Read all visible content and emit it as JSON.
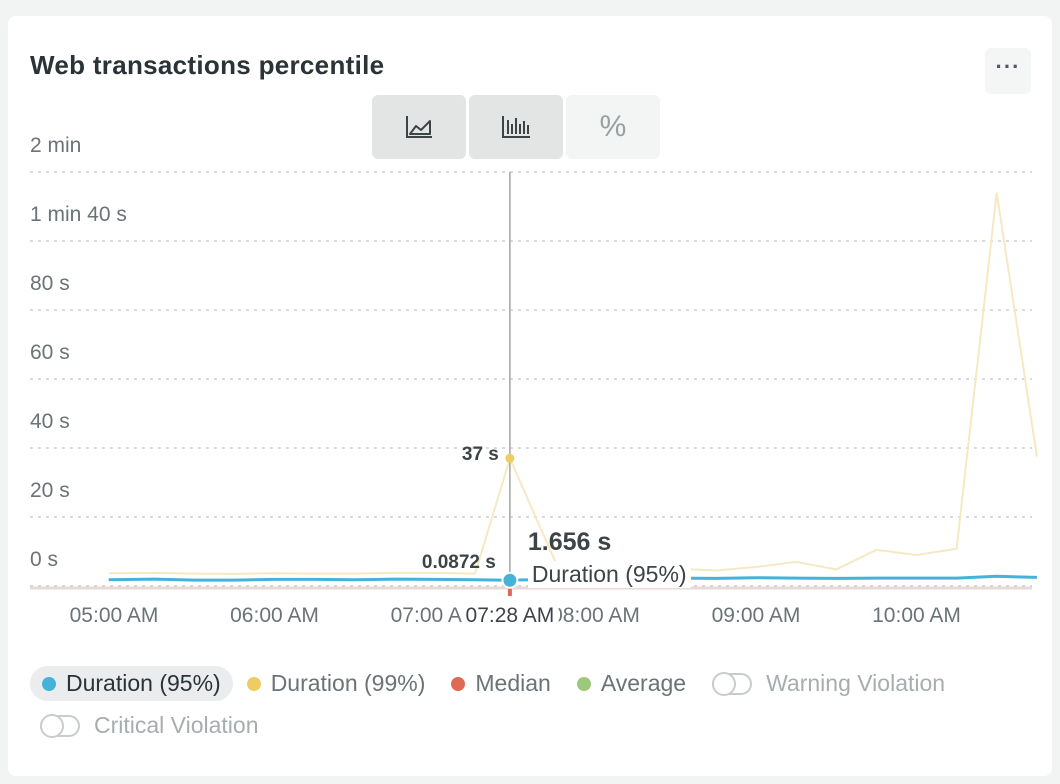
{
  "widget": {
    "title": "Web transactions percentile",
    "more_label": "···"
  },
  "toggles": {
    "percent_label": "%"
  },
  "chart_data": {
    "type": "line",
    "title": "Web transactions percentile",
    "y_ticks": [
      "0 s",
      "20 s",
      "40 s",
      "60 s",
      "80 s",
      "1 min 40 s",
      "2 min"
    ],
    "ylim": [
      0,
      120
    ],
    "x_ticks": [
      "05:00 AM",
      "06:00 AM",
      "07:00 AM",
      "08:00 AM",
      "09:00 AM",
      "10:00 AM"
    ],
    "grid": true,
    "series": [
      {
        "name": "Duration (95%)",
        "color": "#45b3d8",
        "x": [
          "04:58 AM",
          "05:15 AM",
          "05:30 AM",
          "05:45 AM",
          "06:00 AM",
          "06:15 AM",
          "06:30 AM",
          "06:45 AM",
          "07:00 AM",
          "07:15 AM",
          "07:28 AM",
          "07:45 AM",
          "08:00 AM",
          "08:15 AM",
          "08:30 AM",
          "08:45 AM",
          "09:00 AM",
          "09:15 AM",
          "09:30 AM",
          "09:45 AM",
          "10:00 AM",
          "10:15 AM",
          "10:30 AM",
          "10:45 AM"
        ],
        "values": [
          1.8,
          2,
          1.7,
          1.7,
          1.9,
          1.9,
          1.8,
          2,
          1.9,
          1.8,
          1.656,
          2,
          2.2,
          2.3,
          2.3,
          2.2,
          2.4,
          2.3,
          2.2,
          2.3,
          2.3,
          2.3,
          2.8,
          2.5
        ]
      },
      {
        "name": "Duration (99%)",
        "color": "#f6e9c2",
        "x": [
          "04:58 AM",
          "05:15 AM",
          "05:30 AM",
          "05:45 AM",
          "06:00 AM",
          "06:15 AM",
          "06:30 AM",
          "06:45 AM",
          "07:00 AM",
          "07:15 AM",
          "07:28 AM",
          "07:45 AM",
          "08:00 AM",
          "08:15 AM",
          "08:30 AM",
          "08:45 AM",
          "09:00 AM",
          "09:15 AM",
          "09:30 AM",
          "09:45 AM",
          "10:00 AM",
          "10:15 AM",
          "10:30 AM",
          "10:45 AM"
        ],
        "values": [
          3.7,
          3.8,
          3.6,
          3.5,
          3.7,
          3.6,
          3.6,
          3.8,
          3.8,
          3.6,
          37,
          7,
          6.8,
          6.5,
          5,
          4.5,
          5.5,
          7,
          4.8,
          10.5,
          9,
          10.8,
          114,
          37.5
        ]
      },
      {
        "name": "Median",
        "color": "#df6a54",
        "x": [
          "04:58 AM",
          "10:45 AM"
        ],
        "values": [
          0.0872,
          0.0872
        ]
      },
      {
        "name": "Average",
        "color": "#9cc87c",
        "x": [
          "04:58 AM",
          "10:45 AM"
        ],
        "values": [
          0.15,
          0.15
        ]
      }
    ],
    "hover": {
      "time": "07:28 AM",
      "value_label": "1.656 s",
      "series_label": "Duration (95%)",
      "p99_label": "37 s",
      "median_label": "0.0872 s"
    }
  },
  "legend": [
    {
      "label": "Duration (95%)",
      "color": "#45b3d8",
      "selected": true
    },
    {
      "label": "Duration (99%)",
      "color": "#eecb63"
    },
    {
      "label": "Median",
      "color": "#df6a54"
    },
    {
      "label": "Average",
      "color": "#9cc87c"
    }
  ],
  "violations": [
    {
      "label": "Warning Violation"
    },
    {
      "label": "Critical Violation"
    }
  ]
}
